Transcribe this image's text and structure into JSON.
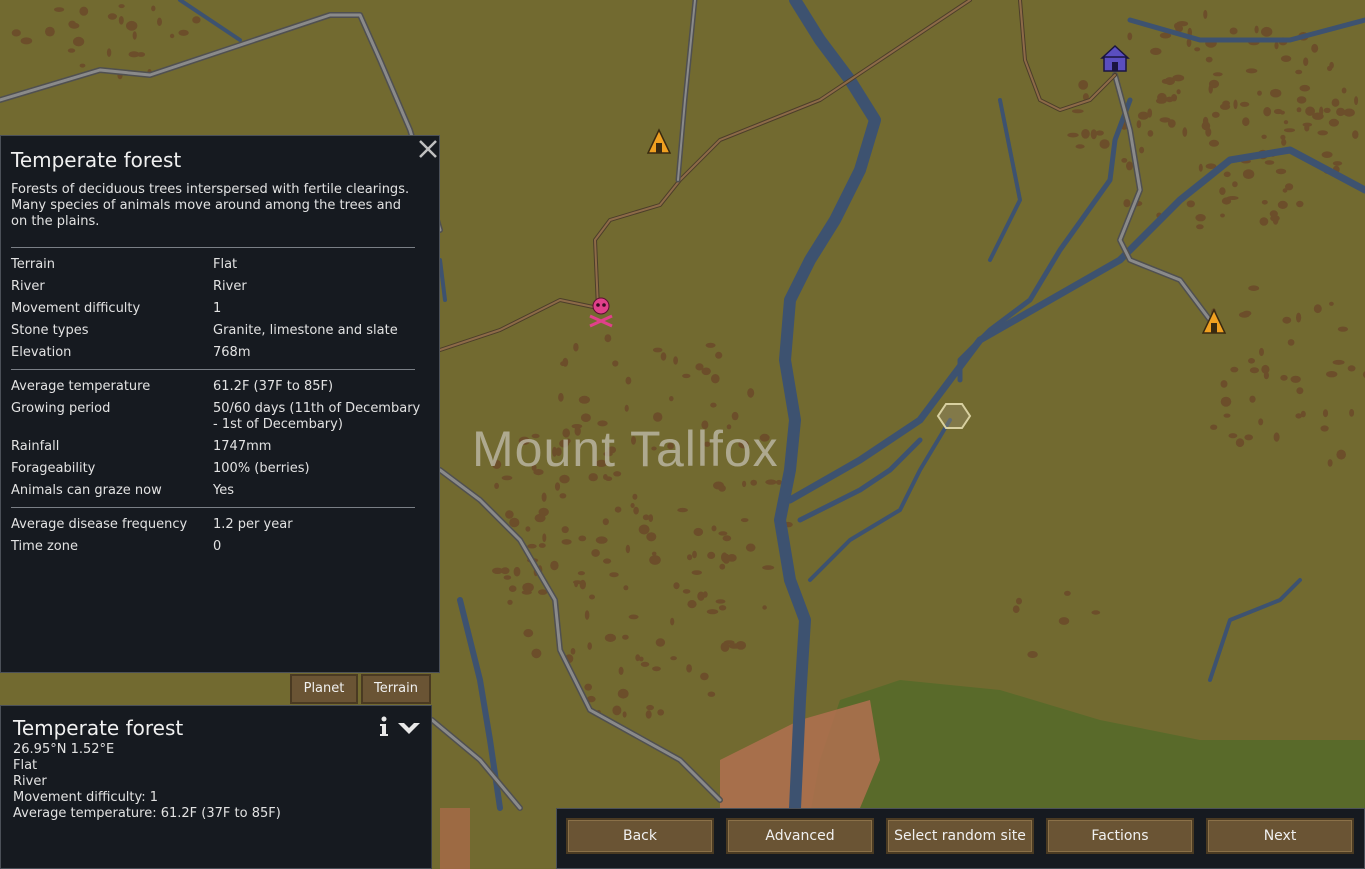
{
  "colors": {
    "map_bg": "#726a30",
    "river": "#3d5270",
    "road": "#7b7b7b",
    "forest_patch": "#6b4a2a",
    "panel_bg": "#161a20",
    "button_bg": "#6a5434",
    "settlement_yellow": "#f0a020",
    "hostile_pink": "#e0408a",
    "home_purple": "#5a4ec0"
  },
  "map": {
    "region_label": "Mount Tallfox",
    "icons": [
      "yellow-tent-icon",
      "yellow-tent-icon",
      "skull-crossbones-icon",
      "purple-house-icon",
      "hex-selection-icon"
    ]
  },
  "info_panel": {
    "title": "Temperate forest",
    "description": "Forests of deciduous trees interspersed with fertile clearings. Many species of animals move around among the trees and on the plains.",
    "rows": [
      {
        "label": "Terrain",
        "value": "Flat"
      },
      {
        "label": "River",
        "value": "River"
      },
      {
        "label": "Movement difficulty",
        "value": "1"
      },
      {
        "label": "Stone types",
        "value": "Granite, limestone and slate"
      },
      {
        "label": "Elevation",
        "value": "768m"
      },
      {
        "label": "Average temperature",
        "value": "61.2F (37F to 85F)"
      },
      {
        "label": "Growing period",
        "value": "50/60 days (11th of Decembary - 1st of Decembary)"
      },
      {
        "label": "Rainfall",
        "value": "1747mm"
      },
      {
        "label": "Forageability",
        "value": "100% (berries)"
      },
      {
        "label": "Animals can graze now",
        "value": "Yes"
      },
      {
        "label": "Average disease frequency",
        "value": "1.2 per year"
      },
      {
        "label": "Time zone",
        "value": "0"
      }
    ]
  },
  "tabs": {
    "planet": "Planet",
    "terrain": "Terrain"
  },
  "inspect_panel": {
    "title": "Temperate forest",
    "coords": "26.95°N 1.52°E",
    "terrain": "Flat",
    "river": "River",
    "movement": "Movement difficulty: 1",
    "temperature": "Average temperature: 61.2F (37F to 85F)"
  },
  "bottom_bar": {
    "back": "Back",
    "advanced": "Advanced",
    "random": "Select random site",
    "factions": "Factions",
    "next": "Next"
  }
}
